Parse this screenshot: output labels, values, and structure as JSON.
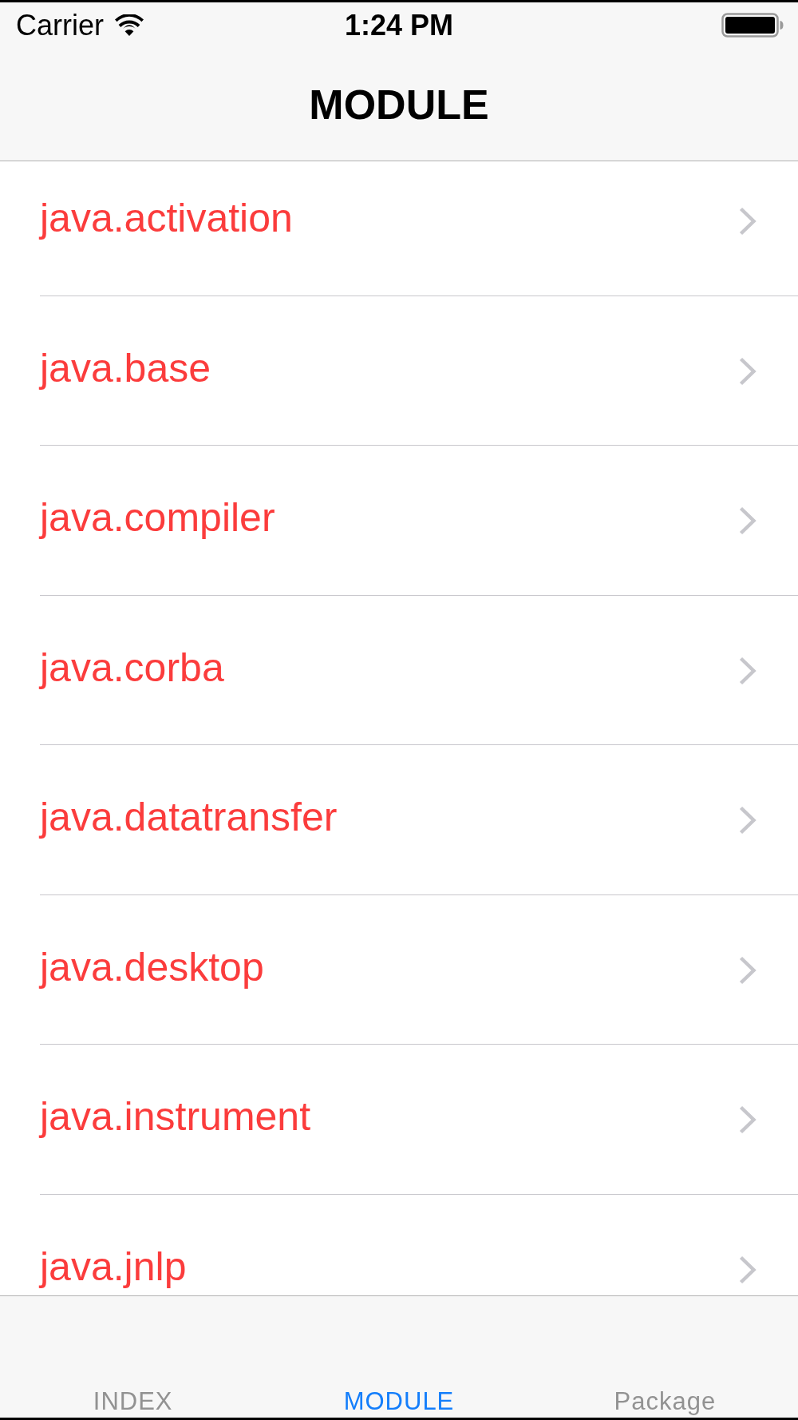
{
  "status_bar": {
    "carrier": "Carrier",
    "time": "1:24 PM"
  },
  "nav_bar": {
    "title": "MODULE"
  },
  "list": {
    "rows": [
      {
        "label": "java.activation"
      },
      {
        "label": "java.base"
      },
      {
        "label": "java.compiler"
      },
      {
        "label": "java.corba"
      },
      {
        "label": "java.datatransfer"
      },
      {
        "label": "java.desktop"
      },
      {
        "label": "java.instrument"
      },
      {
        "label": "java.jnlp"
      }
    ]
  },
  "tab_bar": {
    "tabs": [
      {
        "label": "INDEX",
        "selected": false
      },
      {
        "label": "MODULE",
        "selected": true
      },
      {
        "label": "Package",
        "selected": false
      }
    ]
  }
}
